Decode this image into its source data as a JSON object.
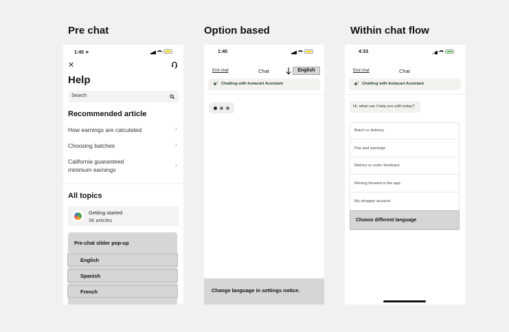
{
  "columns": {
    "pre_chat": "Pre chat",
    "option_based": "Option based",
    "within_chat_flow": "Within chat flow"
  },
  "phone1": {
    "time": "1:40",
    "close_glyph": "✕",
    "help_title": "Help",
    "search_placeholder": "Search",
    "recommended_heading": "Recommended article",
    "articles": [
      {
        "label": "How earnings are calculated"
      },
      {
        "label": "Choosing batches"
      },
      {
        "label_line1": "California guaranteed",
        "label_line2": "minimum earnings"
      }
    ],
    "all_topics_heading": "All topics",
    "topic": {
      "title": "Getting started",
      "count": "36 articles"
    },
    "slider_title": "Pre-chat slider pop-up",
    "languages": [
      "English",
      "Spanish",
      "French"
    ],
    "battery_color": "#f5d400"
  },
  "phone2": {
    "time": "1:40",
    "end_chat": "End chat",
    "chat_title": "Chat",
    "language_button": "English",
    "assistant_banner": "Chatting with Instacart Assistant",
    "notice": "Change language in settings notice.",
    "battery_color": "#f5d400"
  },
  "phone3": {
    "time": "4:33",
    "end_chat": "End chat",
    "chat_title": "Chat",
    "assistant_banner": "Chatting with Instacart Assistant",
    "greeting": "Hi, what can I help you with today?",
    "options": [
      "Batch or delivery",
      "Pay and earnings",
      "Metrics or order feedback",
      "Moving forward in the app",
      "My shopper account"
    ],
    "choose_language": "Choose different language",
    "battery_color": "#49c24a"
  },
  "icons": {
    "close": "close-icon",
    "headset": "headset-icon",
    "search": "search-icon",
    "chevron": "chevron-right-icon",
    "sparkle": "sparkle-icon",
    "arrow_down": "arrow-down-icon",
    "location": "location-arrow-icon"
  }
}
